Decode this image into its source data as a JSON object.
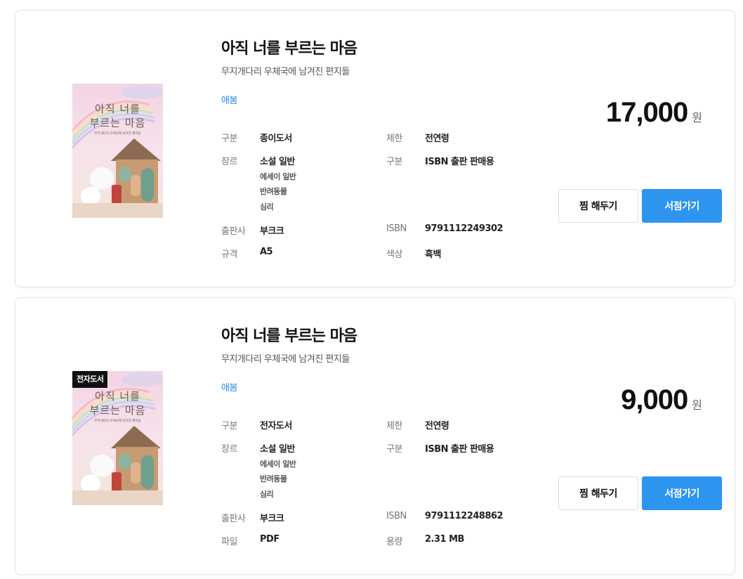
{
  "books": [
    {
      "badge": "",
      "cover": {
        "title": "아직 너를\n부르는 마음",
        "subtitle": "무지개다리 우체국에 남겨진 편지들"
      },
      "title": "아직 너를 부르는 마음",
      "subtitle": "무지개다리 우체국에 남겨진 편지들",
      "author": "애봄",
      "specs": {
        "type_label": "구분",
        "type_value": "종이도서",
        "age_label": "제한",
        "age_value": "전연령",
        "genre_label": "장르",
        "genre_value": "소설 일반",
        "genre_sub": [
          "에세이 일반",
          "반려동물",
          "심리"
        ],
        "dist_label": "구분",
        "dist_value": "ISBN 출판 판매용",
        "publisher_label": "출판사",
        "publisher_value": "부크크",
        "isbn_label": "ISBN",
        "isbn_value": "9791112249302",
        "extra1_label": "규격",
        "extra1_value": "A5",
        "extra2_label": "색상",
        "extra2_value": "흑백"
      },
      "price": "17,000",
      "price_unit": "원",
      "wish_label": "찜 해두기",
      "shop_label": "서점가기"
    },
    {
      "badge": "전자도서",
      "cover": {
        "title": "아직 너를\n부르는 마음",
        "subtitle": "무지개다리 우체국에 남겨진 편지들"
      },
      "title": "아직 너를 부르는 마음",
      "subtitle": "무지개다리 우체국에 남겨진 편지들",
      "author": "애봄",
      "specs": {
        "type_label": "구분",
        "type_value": "전자도서",
        "age_label": "제한",
        "age_value": "전연령",
        "genre_label": "장르",
        "genre_value": "소설 일반",
        "genre_sub": [
          "에세이 일반",
          "반려동물",
          "심리"
        ],
        "dist_label": "구분",
        "dist_value": "ISBN 출판 판매용",
        "publisher_label": "출판사",
        "publisher_value": "부크크",
        "isbn_label": "ISBN",
        "isbn_value": "9791112248862",
        "extra1_label": "파일",
        "extra1_value": "PDF",
        "extra2_label": "용량",
        "extra2_value": "2.31 MB"
      },
      "price": "9,000",
      "price_unit": "원",
      "wish_label": "찜 해두기",
      "shop_label": "서점가기"
    }
  ],
  "colors": {
    "accent": "#2d95f0",
    "author_link": "#2a8be0",
    "badge_bg": "#111111"
  }
}
